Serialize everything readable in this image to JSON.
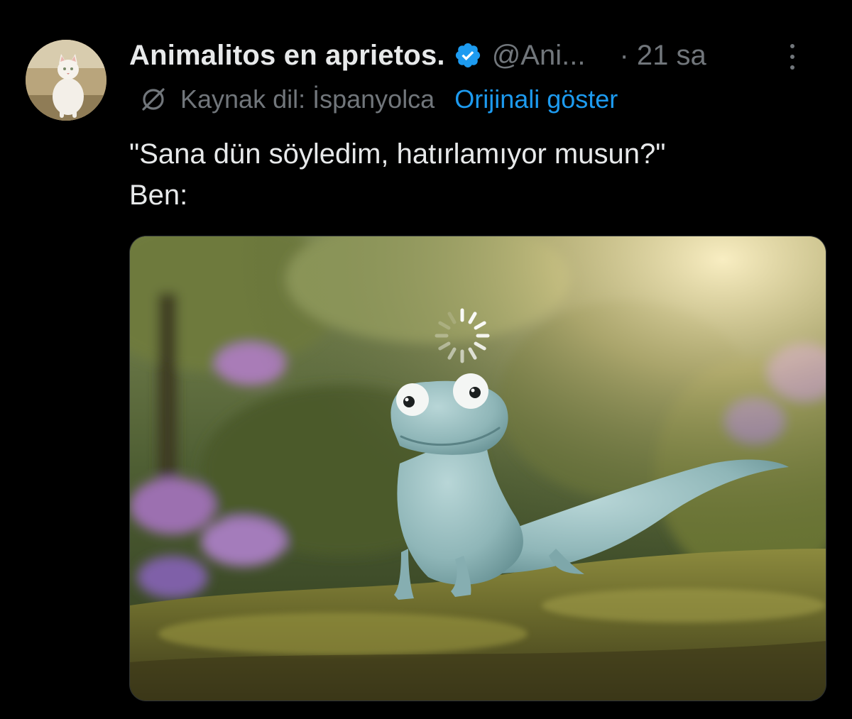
{
  "author": {
    "display_name": "Animalitos en aprietos.",
    "handle": "@Ani...",
    "verified": true,
    "avatar_icon": "cat-avatar"
  },
  "meta": {
    "time": "· 21 sa",
    "more_icon": "more-vertical-icon"
  },
  "translation": {
    "source_language": "Kaynak dil: İspanyolca",
    "show_original": "Orijinali göster",
    "icon": "translate-icon"
  },
  "text": {
    "line1": "\"Sana dün söyledim, hatırlamıyor musun?\"",
    "line2": "Ben:"
  },
  "media": {
    "description_icon": "lizard-loading-image"
  },
  "colors": {
    "background": "#000000",
    "primary_text": "#e7e9ea",
    "secondary_text": "#71767b",
    "link": "#1d9bf0",
    "verified_badge": "#1d9bf0"
  }
}
